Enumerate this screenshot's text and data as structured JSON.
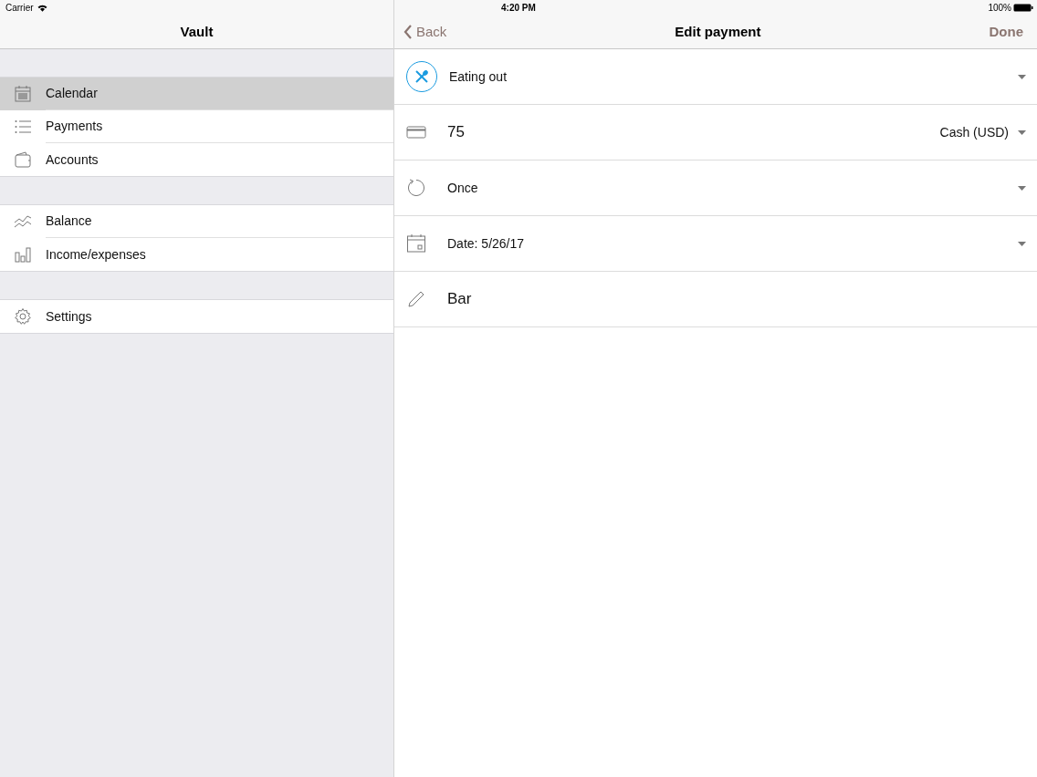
{
  "status_bar": {
    "carrier": "Carrier",
    "time": "4:20 PM",
    "battery": "100%"
  },
  "sidebar": {
    "title": "Vault",
    "sections": [
      {
        "items": [
          {
            "kind": "calendar",
            "label": "Calendar",
            "selected": true
          },
          {
            "kind": "list",
            "label": "Payments",
            "selected": false
          },
          {
            "kind": "wallet",
            "label": "Accounts",
            "selected": false
          }
        ]
      },
      {
        "items": [
          {
            "kind": "trend",
            "label": "Balance",
            "selected": false
          },
          {
            "kind": "bars",
            "label": "Income/expenses",
            "selected": false
          }
        ]
      },
      {
        "items": [
          {
            "kind": "gear",
            "label": "Settings",
            "selected": false
          }
        ]
      }
    ]
  },
  "detail": {
    "back": "Back",
    "title": "Edit payment",
    "done": "Done",
    "rows": [
      {
        "kind": "category",
        "text": "Eating out",
        "dropdown": true
      },
      {
        "kind": "amount",
        "text": "75",
        "trailing": "Cash (USD)",
        "dropdown": true
      },
      {
        "kind": "repeat",
        "text": "Once",
        "dropdown": true
      },
      {
        "kind": "date",
        "text": "Date: 5/26/17",
        "dropdown": true
      },
      {
        "kind": "note",
        "text": "Bar",
        "dropdown": false
      }
    ]
  }
}
